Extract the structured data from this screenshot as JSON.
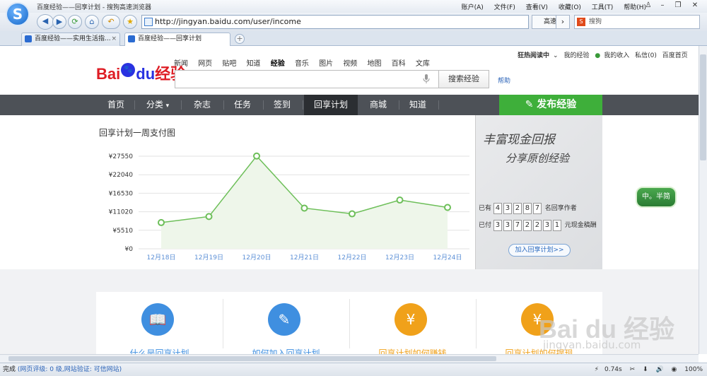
{
  "browser": {
    "title": "百度经验——回享计划 - 搜狗高速浏览器",
    "menu": [
      "账户(A)",
      "文件(F)",
      "查看(V)",
      "收藏(O)",
      "工具(T)",
      "帮助(H)"
    ],
    "url": "http://jingyan.baidu.com/user/income",
    "speed_label": "高速",
    "search_placeholder": "搜狗",
    "tabs": [
      {
        "label": "百度经验——实用生活指...",
        "active": false
      },
      {
        "label": "百度经验——回享计划",
        "active": true
      }
    ]
  },
  "page": {
    "top_links": {
      "reading": "狂热阅读中",
      "my_jingyan": "我的经验",
      "my_income": "我的收入",
      "message": "私信(0)",
      "home": "百度首页"
    },
    "product_nav": [
      "新闻",
      "网页",
      "贴吧",
      "知道",
      "经验",
      "音乐",
      "图片",
      "视频",
      "地图",
      "百科",
      "文库"
    ],
    "product_nav_current": "经验",
    "logo": {
      "bai": "Bai",
      "du": "du",
      "jy": "经验"
    },
    "search_button": "搜索经验",
    "help": "帮助",
    "main_nav": [
      "首页",
      "分类",
      "杂志",
      "任务",
      "签到",
      "回享计划",
      "商城",
      "知道"
    ],
    "main_nav_current": "回享计划",
    "publish_button": "发布经验",
    "chart_title": "回享计划一周支付图",
    "ad": {
      "line1": "丰富现金回报",
      "line2": "分享原创经验",
      "row1_prefix": "已有",
      "row1_digits": [
        "4",
        "3",
        "2",
        "8",
        "7"
      ],
      "row1_suffix": "名回享作者",
      "row2_prefix": "已付",
      "row2_digits": [
        "3",
        "3",
        "7",
        "2",
        "2",
        "3",
        "1"
      ],
      "row2_suffix": "元现金稿酬",
      "join_button": "加入回享计划>>"
    },
    "side_badge": "中。半简",
    "cards": [
      {
        "label": "什么是回享计划",
        "color": "#3f8fe0",
        "icon": "book-icon",
        "glyph": "📖",
        "label_color": "#3f8fe0"
      },
      {
        "label": "如何加入回享计划",
        "color": "#3f8fe0",
        "icon": "edit-icon",
        "glyph": "✎",
        "label_color": "#3f8fe0"
      },
      {
        "label": "回享计划如何赚钱",
        "color": "#f0a11a",
        "icon": "money-bag-icon",
        "glyph": "¥",
        "label_color": "#f0a11a"
      },
      {
        "label": "回享计划如何提现",
        "color": "#f0a11a",
        "icon": "cash-icon",
        "glyph": "¥",
        "label_color": "#f0a11a"
      }
    ],
    "watermark": "Bai du 经验",
    "watermark_url": "jingyan.baidu.com"
  },
  "status": {
    "done": "完成",
    "rating": "(网页评级: 0 级,网站验证: 可信网站)",
    "time": "0.74s",
    "zoom": "100%"
  },
  "chart_data": {
    "type": "area",
    "title": "回享计划一周支付图",
    "categories": [
      "12月18日",
      "12月19日",
      "12月20日",
      "12月21日",
      "12月22日",
      "12月23日",
      "12月24日"
    ],
    "y_tick_labels": [
      "¥0",
      "¥5510",
      "¥11020",
      "¥16530",
      "¥22040",
      "¥27550"
    ],
    "y_ticks": [
      0,
      5510,
      11020,
      16530,
      22040,
      27550
    ],
    "ylim": [
      0,
      27550
    ],
    "values": [
      7800,
      9600,
      27600,
      12100,
      10400,
      14500,
      12300
    ],
    "grid": true,
    "line_color": "#6dbf59",
    "fill_color": "#eef6ea"
  }
}
